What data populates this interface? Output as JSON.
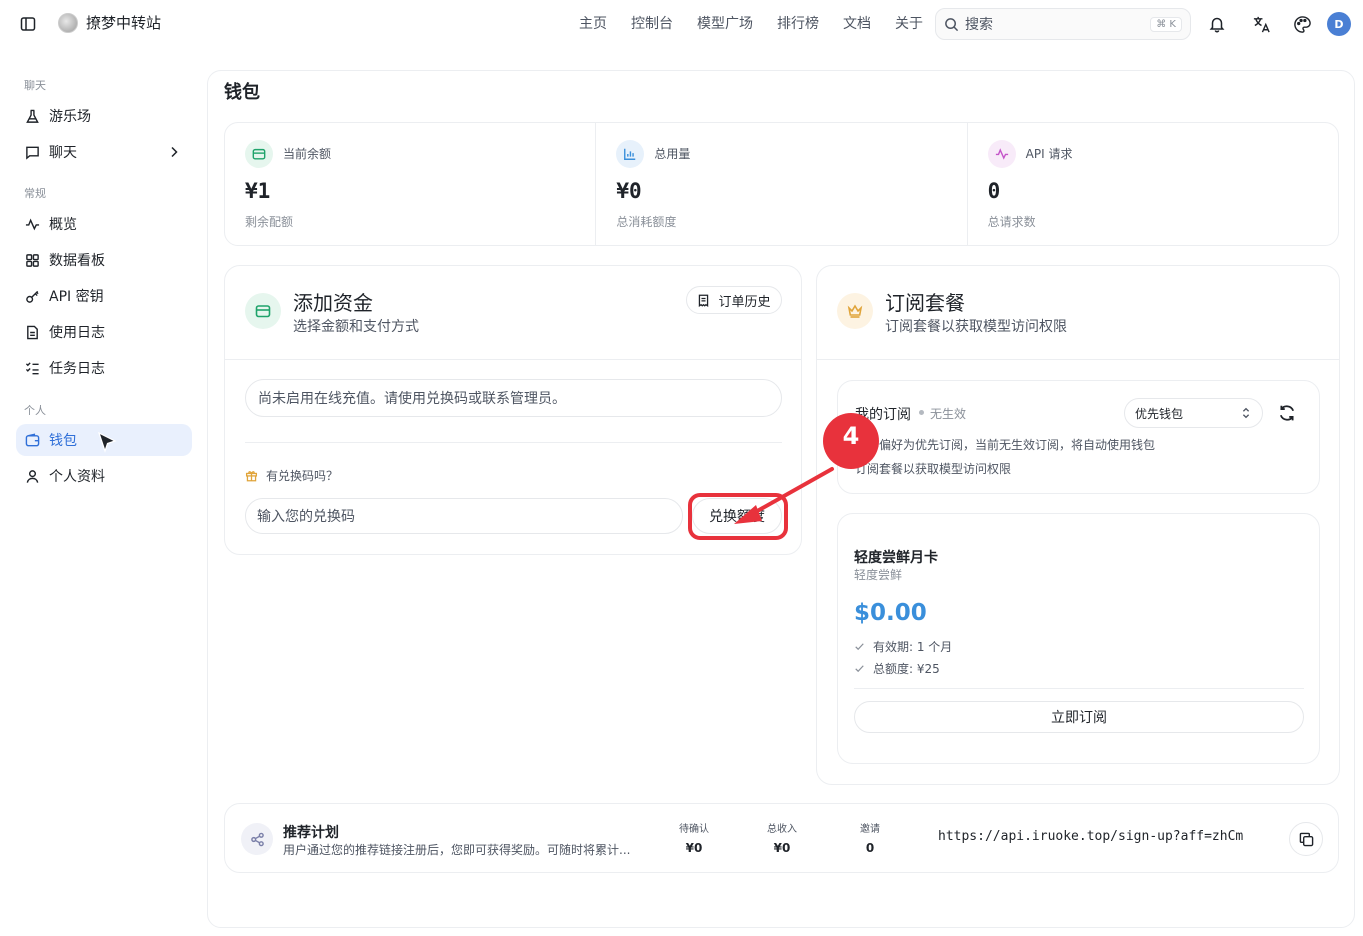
{
  "header": {
    "brand": "撩梦中转站",
    "nav": [
      "主页",
      "控制台",
      "模型广场",
      "排行榜",
      "文档",
      "关于"
    ],
    "search_placeholder": "搜索",
    "search_shortcut": "⌘ K",
    "avatar_initial": "D"
  },
  "sidebar": {
    "sections": {
      "chat": "聊天",
      "general": "常规",
      "personal": "个人"
    },
    "items": {
      "playground": "游乐场",
      "chat": "聊天",
      "overview": "概览",
      "dashboard": "数据看板",
      "api_keys": "API 密钥",
      "usage_logs": "使用日志",
      "task_logs": "任务日志",
      "wallet": "钱包",
      "profile": "个人资料"
    },
    "active": "wallet"
  },
  "page": {
    "title": "钱包"
  },
  "stats": [
    {
      "label": "当前余额",
      "value": "¥1",
      "sub": "剩余配额",
      "color": "#1fa36b"
    },
    {
      "label": "总用量",
      "value": "¥0",
      "sub": "总消耗额度",
      "color": "#3a8fdb"
    },
    {
      "label": "API 请求",
      "value": "0",
      "sub": "总请求数",
      "color": "#c455c9"
    }
  ],
  "add_funds": {
    "title": "添加资金",
    "subtitle": "选择金额和支付方式",
    "history_button": "订单历史",
    "notice": "尚未启用在线充值。请使用兑换码或联系管理员。",
    "redeem_question": "有兑换码吗？",
    "redeem_placeholder": "输入您的兑换码",
    "redeem_button": "兑换额度"
  },
  "subscription": {
    "title": "订阅套餐",
    "subtitle": "订阅套餐以获取模型访问权限",
    "my_subscription": "我的订阅",
    "status": "无生效",
    "preference": "优先钱包",
    "desc_line1": "保存偏好为优先订阅，当前无生效订阅，将自动使用钱包",
    "desc_line2": "订阅套餐以获取模型访问权限",
    "plan": {
      "name": "轻度尝鲜月卡",
      "subtitle": "轻度尝鲜",
      "price": "$0.00",
      "features": [
        "有效期: 1 个月",
        "总额度: ¥25"
      ],
      "button": "立即订阅"
    }
  },
  "referral": {
    "title": "推荐计划",
    "desc": "用户通过您的推荐链接注册后，您即可获得奖励。可随时将累计...",
    "stats": [
      {
        "label": "待确认",
        "value": "¥0"
      },
      {
        "label": "总收入",
        "value": "¥0"
      },
      {
        "label": "邀请",
        "value": "0"
      }
    ],
    "url": "https://api.iruoke.top/sign-up?aff=zhCm"
  },
  "annotation": {
    "number": "4",
    "color": "#e8323c"
  }
}
